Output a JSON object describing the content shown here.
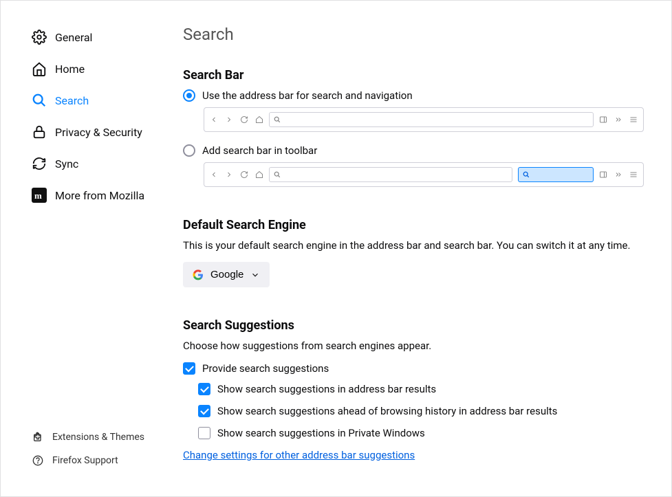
{
  "sidebar": {
    "items": {
      "general": "General",
      "home": "Home",
      "search": "Search",
      "privacy": "Privacy & Security",
      "sync": "Sync",
      "mozilla": "More from Mozilla"
    },
    "footer": {
      "extensions": "Extensions & Themes",
      "support": "Firefox Support"
    }
  },
  "page": {
    "title": "Search"
  },
  "search_bar": {
    "heading": "Search Bar",
    "option_address": "Use the address bar for search and navigation",
    "option_toolbar": "Add search bar in toolbar"
  },
  "default_engine": {
    "heading": "Default Search Engine",
    "desc": "This is your default search engine in the address bar and search bar. You can switch it at any time.",
    "selected": "Google"
  },
  "suggestions": {
    "heading": "Search Suggestions",
    "desc": "Choose how suggestions from search engines appear.",
    "provide": "Provide search suggestions",
    "addr_results": "Show search suggestions in address bar results",
    "ahead_history": "Show search suggestions ahead of browsing history in address bar results",
    "private": "Show search suggestions in Private Windows",
    "other_link": "Change settings for other address bar suggestions"
  }
}
